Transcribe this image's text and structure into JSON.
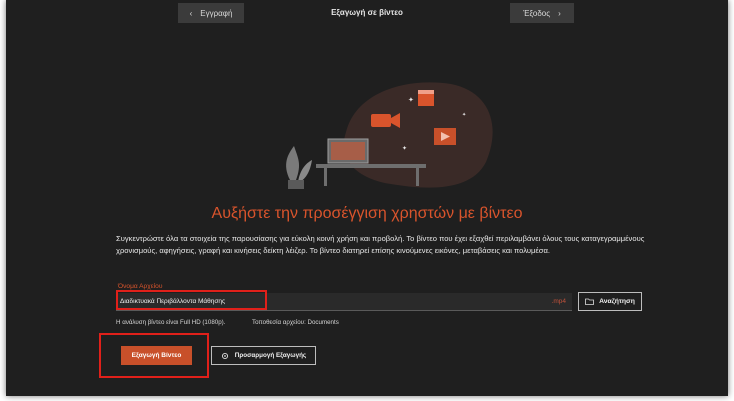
{
  "topbar": {
    "back_label": "Εγγραφή",
    "title": "Εξαγωγή σε βίντεο",
    "next_label": "Έξοδος"
  },
  "main": {
    "headline": "Αυξήστε την προσέγγιση χρηστών με βίντεο",
    "description": "Συγκεντρώστε όλα τα στοιχεία της παρουσίασης για εύκολη κοινή χρήση και προβολή. Το βίντεο που έχει εξαχθεί περιλαμβάνει όλους τους καταγεγραμμένους χρονισμούς, αφηγήσεις, γραφή και κινήσεις δείκτη λέιζερ. Το βίντεο διατηρεί επίσης κινούμενες εικόνες, μεταβάσεις και πολυμέσα."
  },
  "filename": {
    "label": "Όνομα Αρχείου",
    "value": "Διαδικτυακά Περιβάλλοντα Μάθησης",
    "extension": ".mp4"
  },
  "browse": {
    "label": "Αναζήτηση",
    "icon": "folder-icon"
  },
  "info": {
    "resolution": "Η ανάλυση βίντεο είναι Full HD (1080p).",
    "location": "Τοποθεσία αρχείου: Documents"
  },
  "buttons": {
    "export_label": "Εξαγωγή Βίντεο",
    "customize_label": "Προσαρμογή Εξαγωγής",
    "customize_icon": "gear-icon"
  },
  "colors": {
    "background": "#1f1f1f",
    "accent": "#d9542c",
    "highlight": "#e0201a"
  }
}
